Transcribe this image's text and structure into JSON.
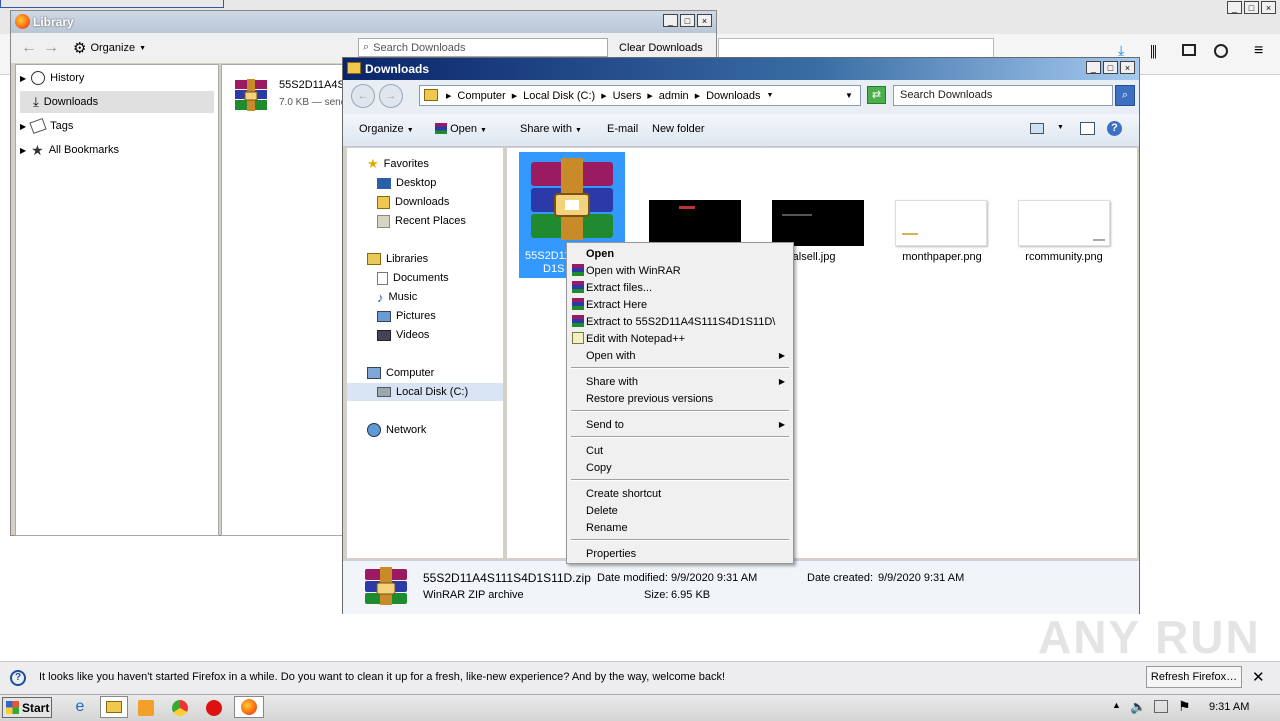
{
  "firefox": {
    "title_buttons": [
      "_",
      "□",
      "×"
    ]
  },
  "library": {
    "title": "Library",
    "organize": "Organize",
    "search_placeholder": "Search Downloads",
    "clear_downloads": "Clear Downloads",
    "tree": [
      {
        "label": "History",
        "icon": "clock-icon"
      },
      {
        "label": "Downloads",
        "icon": "download-icon"
      },
      {
        "label": "Tags",
        "icon": "tag-icon"
      },
      {
        "label": "All Bookmarks",
        "icon": "star-icon"
      }
    ],
    "download_item": {
      "name": "55S2D11A4S",
      "meta": "7.0 KB — send"
    }
  },
  "explorer": {
    "title": "Downloads",
    "breadcrumb": [
      "Computer",
      "Local Disk (C:)",
      "Users",
      "admin",
      "Downloads"
    ],
    "search_placeholder": "Search Downloads",
    "commands": [
      "Organize",
      "Open",
      "Share with",
      "E-mail",
      "New folder"
    ],
    "nav": {
      "favorites": "Favorites",
      "desktop": "Desktop",
      "downloads": "Downloads",
      "recent": "Recent Places",
      "libraries": "Libraries",
      "documents": "Documents",
      "music": "Music",
      "pictures": "Pictures",
      "videos": "Videos",
      "computer": "Computer",
      "local_disk": "Local Disk (C:)",
      "network": "Network"
    },
    "files": [
      {
        "name": "55S2D11",
        "name2": "D1S",
        "type": "zip"
      },
      {
        "name": "",
        "type": "dark"
      },
      {
        "name": "vidualsell.jpg",
        "type": "dark"
      },
      {
        "name": "monthpaper.png",
        "type": "white"
      },
      {
        "name": "rcommunity.png",
        "type": "white"
      }
    ],
    "details": {
      "filename": "55S2D11A4S111S4D1S11D.zip",
      "filetype": "WinRAR ZIP archive",
      "date_modified_label": "Date modified:",
      "date_modified": "9/9/2020 9:31 AM",
      "size_label": "Size:",
      "size": "6.95 KB",
      "date_created_label": "Date created:",
      "date_created": "9/9/2020 9:31 AM"
    }
  },
  "context_menu": {
    "items": [
      {
        "label": "Open",
        "bold": true
      },
      {
        "label": "Open with WinRAR",
        "icon": "winrar"
      },
      {
        "label": "Extract files...",
        "icon": "winrar"
      },
      {
        "label": "Extract Here",
        "icon": "winrar"
      },
      {
        "label": "Extract to 55S2D11A4S111S4D1S11D\\",
        "icon": "winrar"
      },
      {
        "label": "Edit with Notepad++",
        "icon": "notepad"
      },
      {
        "label": "Open with",
        "submenu": true
      },
      {
        "label": "Share with",
        "submenu": true
      },
      {
        "label": "Restore previous versions"
      },
      {
        "label": "Send to",
        "submenu": true
      },
      {
        "label": "Cut"
      },
      {
        "label": "Copy"
      },
      {
        "label": "Create shortcut"
      },
      {
        "label": "Delete"
      },
      {
        "label": "Rename"
      },
      {
        "label": "Properties"
      }
    ]
  },
  "notification": {
    "text": "It looks like you haven't started Firefox in a while. Do you want to clean it up for a fresh, like-new experience? And by the way, welcome back!",
    "button": "Refresh Firefox…"
  },
  "taskbar": {
    "start": "Start",
    "clock": "9:31 AM"
  },
  "watermark": "ANY RUN",
  "colors": {
    "selection": "#3399ff",
    "title_bar": "#0a246a"
  }
}
